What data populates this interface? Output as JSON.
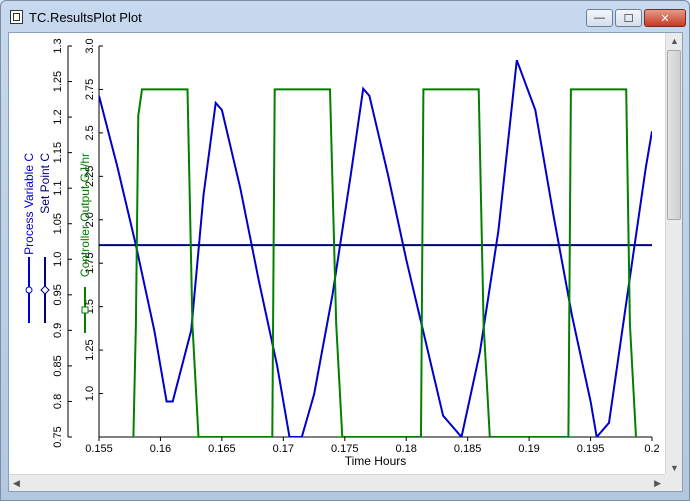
{
  "window": {
    "title": "TC.ResultsPlot Plot",
    "minimize_label": "—",
    "maximize_label": "☐",
    "close_label": "✕"
  },
  "scroll": {
    "up": "▲",
    "down": "▼",
    "left": "◀",
    "right": "▶"
  },
  "colors": {
    "process": "#0000cc",
    "setpoint": "#000080",
    "output": "#007f00"
  },
  "chart_data": {
    "type": "line",
    "xlabel": "Time Hours",
    "xlim": [
      0.155,
      0.2
    ],
    "xticks": [
      "0.155",
      "0.16",
      "0.165",
      "0.17",
      "0.175",
      "0.18",
      "0.185",
      "0.19",
      "0.195",
      "0.2"
    ],
    "axes": [
      {
        "label": "Process Variable C",
        "color": "#0000cc",
        "marker": "circle",
        "ylim": [
          0.75,
          1.3
        ],
        "ticks": [
          "0.75",
          "0.8",
          "0.85",
          "0.9",
          "0.95",
          "1.0",
          "1.05",
          "1.1",
          "1.15",
          "1.2",
          "1.25",
          "1.3"
        ]
      },
      {
        "label": "Set Point C",
        "color": "#000080",
        "marker": "diamond",
        "ylim": [
          0.75,
          1.3
        ],
        "ticks": []
      },
      {
        "label": "Controller Output GJ/hr",
        "color": "#007f00",
        "marker": "square",
        "ylim": [
          0.75,
          3.0
        ],
        "ticks": [
          "1.0",
          "1.25",
          "1.5",
          "1.75",
          "2.0",
          "2.25",
          "2.5",
          "2.75",
          "3.0"
        ]
      }
    ],
    "series": [
      {
        "name": "Process Variable C",
        "axis": 0,
        "x": [
          0.155,
          0.1565,
          0.158,
          0.1595,
          0.1605,
          0.161,
          0.1625,
          0.1635,
          0.1645,
          0.165,
          0.1665,
          0.168,
          0.1695,
          0.1705,
          0.1715,
          0.1725,
          0.174,
          0.1755,
          0.1765,
          0.177,
          0.1785,
          0.18,
          0.1815,
          0.183,
          0.1845,
          0.186,
          0.1875,
          0.1885,
          0.189,
          0.1905,
          0.192,
          0.1935,
          0.195,
          0.1955,
          0.1965,
          0.198,
          0.1995,
          0.2
        ],
        "y": [
          1.23,
          1.13,
          1.02,
          0.9,
          0.8,
          0.8,
          0.9,
          1.09,
          1.22,
          1.21,
          1.1,
          0.97,
          0.85,
          0.75,
          0.75,
          0.81,
          0.95,
          1.12,
          1.24,
          1.23,
          1.12,
          1.0,
          0.89,
          0.78,
          0.75,
          0.87,
          1.04,
          1.2,
          1.28,
          1.21,
          1.06,
          0.92,
          0.8,
          0.75,
          0.77,
          0.95,
          1.13,
          1.18
        ]
      },
      {
        "name": "Set Point C",
        "axis": 1,
        "x": [
          0.155,
          0.2
        ],
        "y": [
          1.02,
          1.02
        ]
      },
      {
        "name": "Controller Output GJ/hr",
        "axis": 2,
        "x": [
          0.1578,
          0.158,
          0.1582,
          0.1585,
          0.159,
          0.1622,
          0.1626,
          0.1631,
          0.1691,
          0.1693,
          0.1695,
          0.1738,
          0.1743,
          0.1748,
          0.1812,
          0.1814,
          0.1816,
          0.1859,
          0.1863,
          0.1868,
          0.1932,
          0.1934,
          0.1936,
          0.1979,
          0.1982,
          0.1987
        ],
        "y": [
          0.75,
          1.4,
          2.6,
          2.75,
          2.75,
          2.75,
          1.4,
          0.75,
          0.75,
          2.75,
          2.75,
          2.75,
          1.4,
          0.75,
          0.75,
          2.75,
          2.75,
          2.75,
          1.4,
          0.75,
          0.75,
          2.75,
          2.75,
          2.75,
          1.4,
          0.75
        ]
      }
    ]
  }
}
